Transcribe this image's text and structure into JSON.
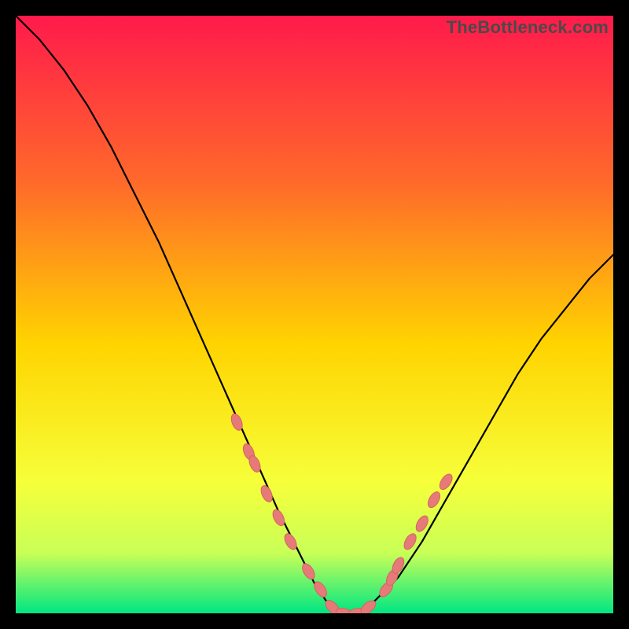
{
  "watermark": "TheBottleneck.com",
  "colors": {
    "background": "#000000",
    "gradient_top": "#ff1a4b",
    "gradient_mid_upper": "#ff6a2a",
    "gradient_mid": "#ffd400",
    "gradient_mid_lower": "#f6ff3a",
    "gradient_lower": "#c8ff57",
    "gradient_bottom": "#00e682",
    "curve": "#000000",
    "marker_fill": "#e67a78",
    "marker_stroke": "#d46360"
  },
  "chart_data": {
    "type": "line",
    "title": "",
    "xlabel": "",
    "ylabel": "",
    "xlim": [
      0,
      100
    ],
    "ylim": [
      0,
      100
    ],
    "grid": false,
    "legend": false,
    "series": [
      {
        "name": "bottleneck-curve",
        "x": [
          0,
          4,
          8,
          12,
          16,
          20,
          24,
          28,
          32,
          36,
          40,
          44,
          48,
          50,
          52,
          54,
          56,
          58,
          60,
          64,
          68,
          72,
          76,
          80,
          84,
          88,
          92,
          96,
          100
        ],
        "y": [
          100,
          96,
          91,
          85,
          78,
          70,
          62,
          53,
          44,
          35,
          26,
          17,
          9,
          5,
          2,
          0,
          0,
          0,
          2,
          6,
          12,
          19,
          26,
          33,
          40,
          46,
          51,
          56,
          60
        ]
      }
    ],
    "markers": {
      "name": "highlighted-points",
      "x": [
        37,
        39,
        40,
        42,
        44,
        46,
        49,
        51,
        53,
        55,
        57,
        59,
        62,
        63,
        64,
        66,
        68,
        70,
        72
      ],
      "y": [
        32,
        27,
        25,
        20,
        16,
        12,
        7,
        4,
        1,
        0,
        0,
        1,
        4,
        6,
        8,
        12,
        15,
        19,
        22
      ]
    }
  }
}
